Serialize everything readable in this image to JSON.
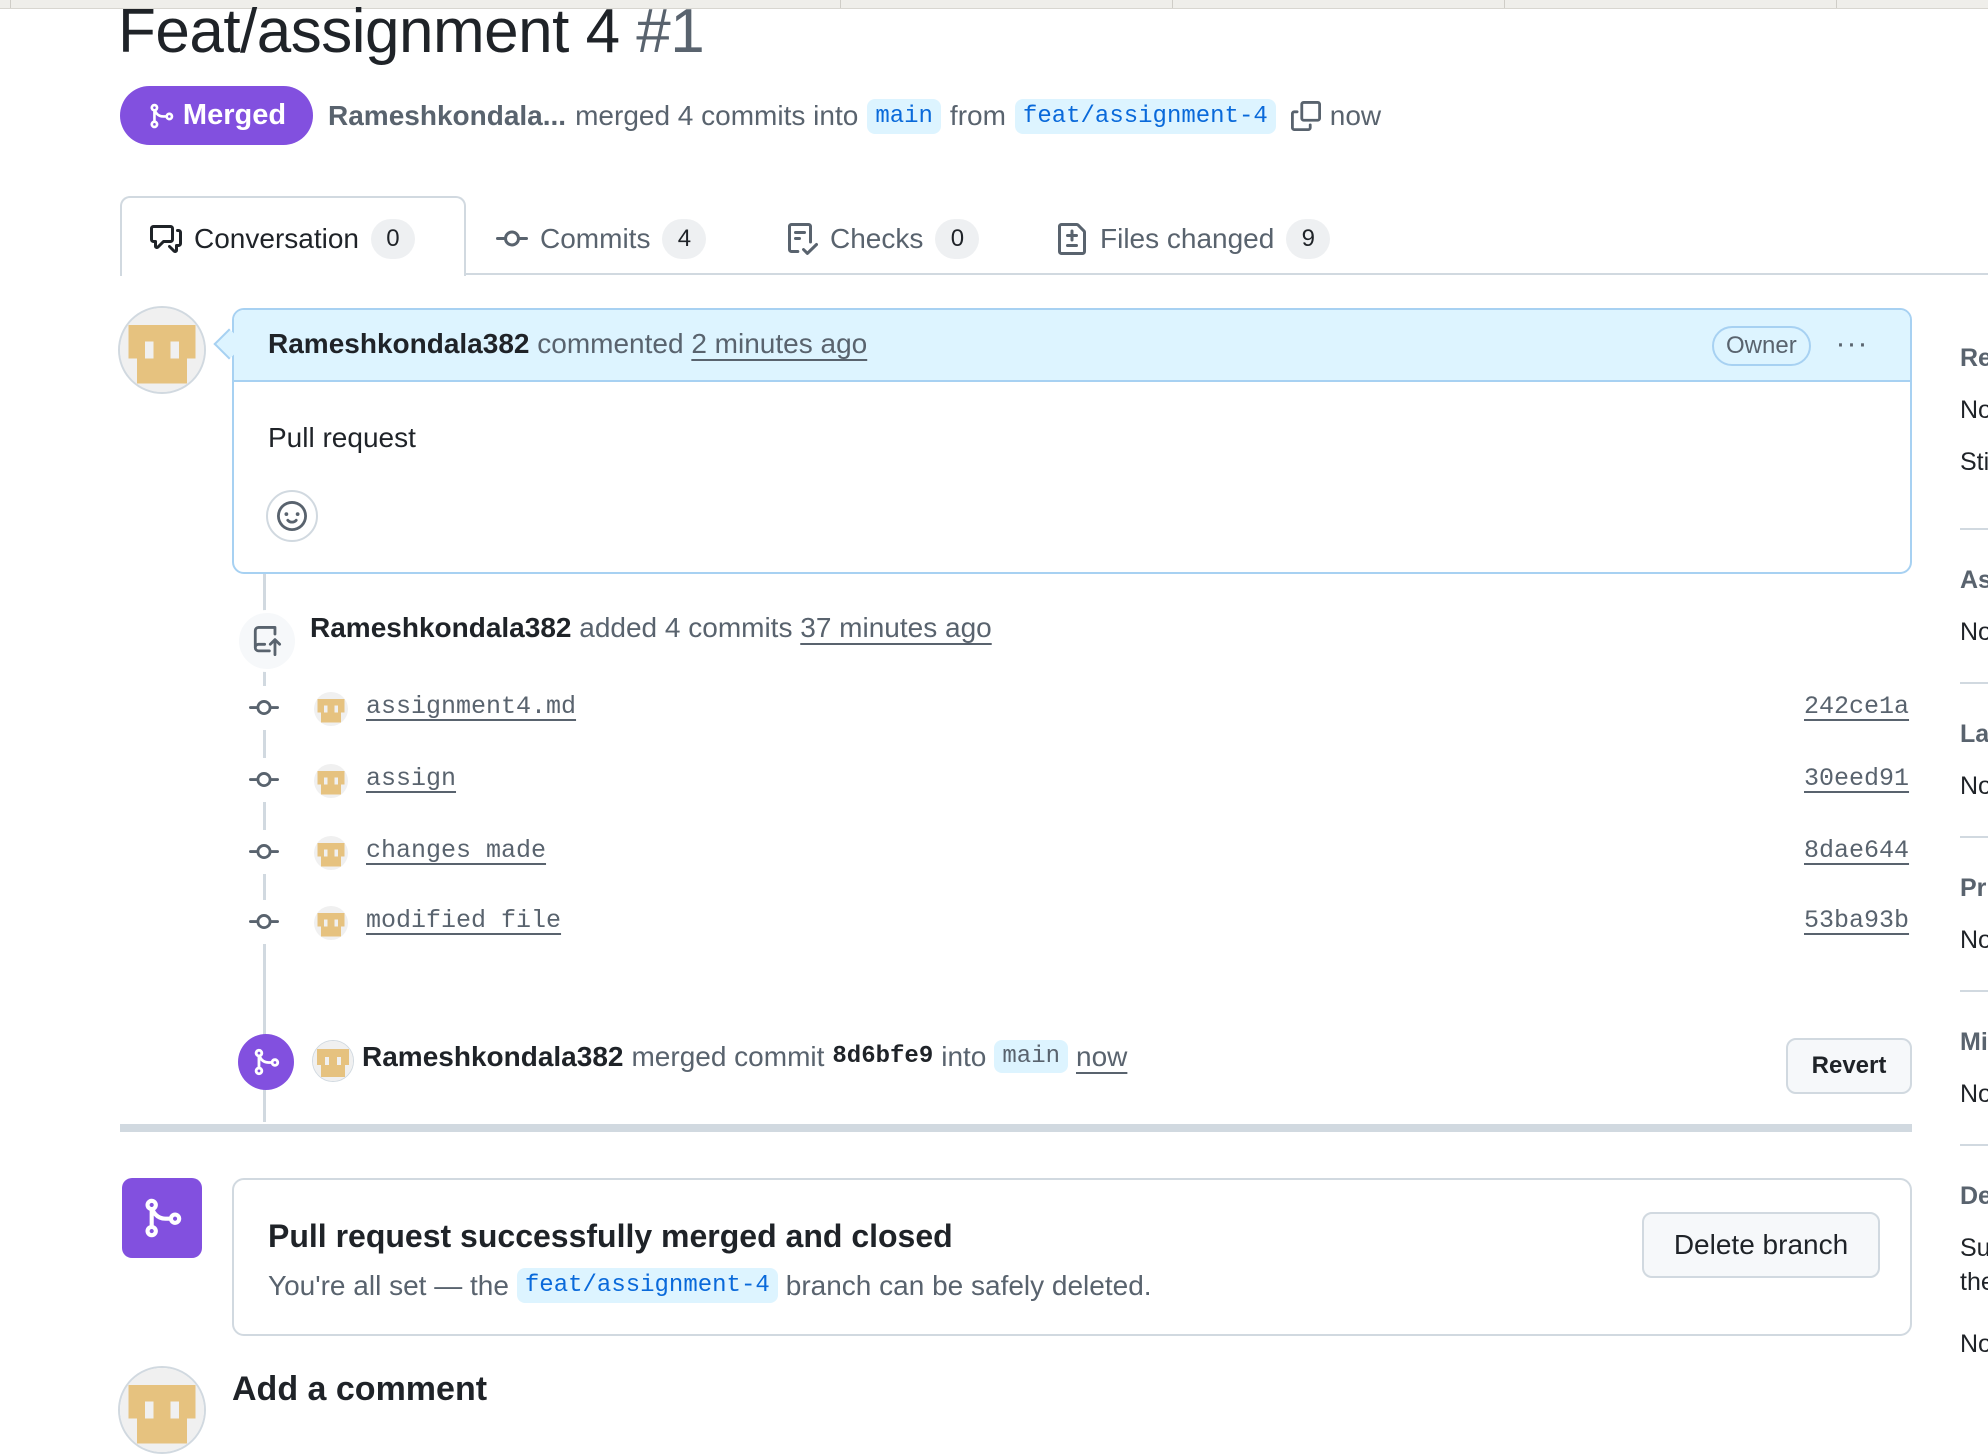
{
  "title": "Feat/assignment 4",
  "pr_number": "#1",
  "state_badge": "Merged",
  "meta": {
    "author": "Rameshkondala...",
    "action": "merged 4 commits into",
    "base_branch": "main",
    "from": "from",
    "head_branch": "feat/assignment-4",
    "time": "now"
  },
  "tabs": [
    {
      "label": "Conversation",
      "count": "0"
    },
    {
      "label": "Commits",
      "count": "4"
    },
    {
      "label": "Checks",
      "count": "0"
    },
    {
      "label": "Files changed",
      "count": "9"
    }
  ],
  "comment": {
    "author": "Rameshkondala382",
    "verb": "commented",
    "time": "2 minutes ago",
    "role": "Owner",
    "more": "···",
    "body": "Pull request"
  },
  "commits_event": {
    "author": "Rameshkondala382",
    "text": "added 4 commits",
    "time": "37 minutes ago"
  },
  "commits": [
    {
      "message": "assignment4.md",
      "sha": "242ce1a"
    },
    {
      "message": "assign",
      "sha": "30eed91"
    },
    {
      "message": "changes made",
      "sha": "8dae644"
    },
    {
      "message": "modified file",
      "sha": "53ba93b"
    }
  ],
  "merge_event": {
    "author": "Rameshkondala382",
    "text": "merged commit",
    "sha": "8d6bfe9",
    "into": "into",
    "branch": "main",
    "time": "now",
    "revert_label": "Revert"
  },
  "merged_box": {
    "title": "Pull request successfully merged and closed",
    "sub_before": "You're all set — the",
    "branch": "feat/assignment-4",
    "sub_after": "branch can be safely deleted.",
    "delete_label": "Delete branch"
  },
  "add_comment": "Add a comment",
  "sidebar": {
    "reviewers_h": "Re",
    "reviewers_t1": "No",
    "reviewers_t2": "Sti",
    "assignees_h": "As",
    "assignees_t": "No",
    "labels_h": "La",
    "labels_t": "No",
    "projects_h": "Pr",
    "projects_t": "No",
    "milestone_h": "Mi",
    "milestone_t": "No",
    "development_h": "De",
    "development_t1": "Su",
    "development_t2": "the",
    "development_t3": "No"
  },
  "colors": {
    "merged_purple": "#8250df",
    "link_blue": "#0969da",
    "branch_bg": "#ddf4ff",
    "identicon_gold": "#e6c27f"
  },
  "icons": {
    "merge": "git-merge-icon",
    "copy": "copy-icon",
    "conversation": "comment-discussion-icon",
    "commits": "git-commit-icon",
    "checks": "checklist-icon",
    "files": "file-diff-icon",
    "push": "repo-push-icon",
    "smiley": "smiley-icon"
  }
}
